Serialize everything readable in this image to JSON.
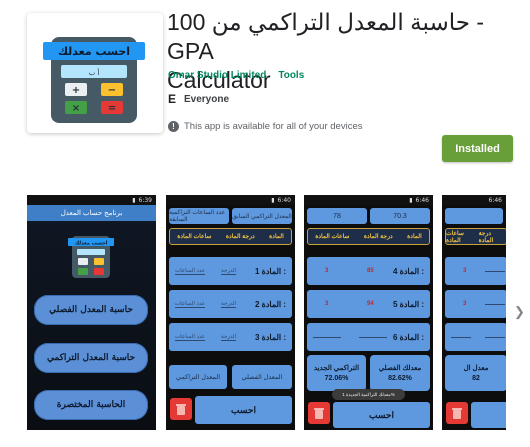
{
  "app": {
    "title_line1": "حاسبة المعدل التراكمي من 100 - GPA",
    "title_line2": "Calculator",
    "developer": "Omar Studio Limited",
    "category": "Tools",
    "content_rating_icon": "E",
    "content_rating": "Everyone",
    "availability": "This app is available for all of your devices",
    "install_status": "Installed",
    "icon_banner": "احسب معدلك",
    "icon_display": "أ ب"
  },
  "colors": {
    "install_green": "#689f38",
    "developer_green": "#01875f",
    "app_blue": "#5e98de",
    "header_blue": "#3f7fc8",
    "heading_gold": "#f4c542"
  },
  "screenshots": {
    "shot1": {
      "time": "6:39",
      "header": "برنامج حساب المعدل",
      "banner": "احسب معدلك",
      "buttons": [
        "حاسبة المعدل الفصلي",
        "حاسبة المعدل التراكمي",
        "الحاسبة المختصرة"
      ]
    },
    "shot2": {
      "time": "6:40",
      "top_buttons": [
        "المعدل التراكمي السابق",
        "عدد الساعات التراكمية السابقة"
      ],
      "headings": [
        "المادة",
        "درجة المادة",
        "ساعات المادة"
      ],
      "subjects": [
        "المادة 1 :",
        "المادة 2 :",
        "المادة 3 :"
      ],
      "grade_placeholder": "الدرجة",
      "hours_placeholder": "عدد الساعات",
      "mode_buttons": [
        "المعدل الفصلي",
        "المعدل التراكمي"
      ],
      "calculate": "احسب"
    },
    "shot3": {
      "time": "6:46",
      "prev_gpa": "70.3",
      "prev_hours": "78",
      "headings": [
        "المادة",
        "درجة المادة",
        "ساعات المادة"
      ],
      "subjects": [
        {
          "label": "المادة 4 :",
          "grade": "85",
          "hours": "3"
        },
        {
          "label": "المادة 5 :",
          "grade": "94",
          "hours": "3"
        },
        {
          "label": "المادة 6 :",
          "grade": "",
          "hours": ""
        }
      ],
      "semester_gpa_label": "معدلك الفصلي",
      "semester_gpa": "82.62%",
      "cumulative_gpa_label": "التراكمي الجديد",
      "cumulative_gpa": "72.06%",
      "toast": "معدلك التراكمية الجديدة 1%",
      "calculate": "احسب"
    },
    "shot4": {
      "time": "6:46",
      "headings": [
        "المادة",
        "درجة المادة",
        "ساعات المادة"
      ],
      "values": [
        "3",
        "3"
      ],
      "result_label": "معدل ال",
      "result": "82"
    }
  },
  "nav": {
    "next_icon": "chevron-right-icon"
  }
}
